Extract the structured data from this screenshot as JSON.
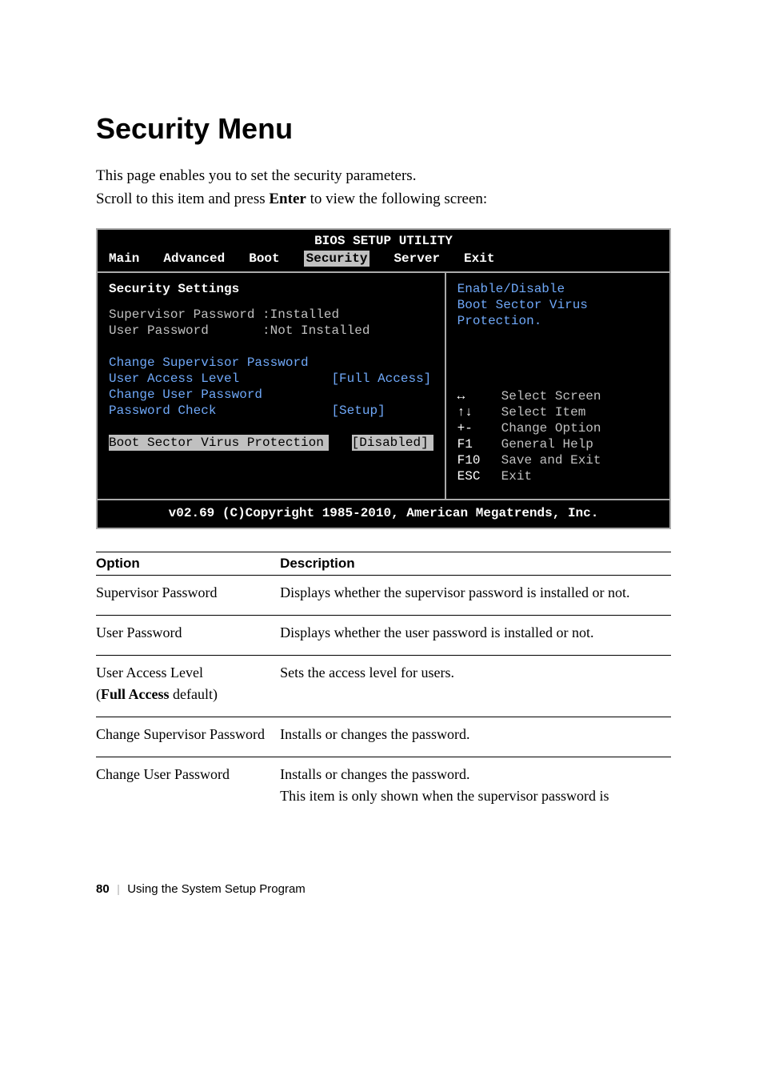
{
  "heading": "Security Menu",
  "intro_line1": "This page enables you to set the security parameters.",
  "intro_line2_a": "Scroll to this item and press ",
  "intro_line2_b": "Enter",
  "intro_line2_c": " to view the following screen:",
  "bios": {
    "title": "BIOS SETUP UTILITY",
    "tabs": {
      "main": "Main",
      "advanced": "Advanced",
      "boot": "Boot",
      "security": "Security",
      "server": "Server",
      "exit": "Exit"
    },
    "left": {
      "section": "Security Settings",
      "sup_label": "Supervisor Password :",
      "sup_val": "Installed",
      "user_label": "User Password       :",
      "user_val": "Not Installed",
      "item_change_sup": "Change Supervisor Password",
      "item_ual": "User Access Level",
      "item_ual_val": "[Full Access]",
      "item_change_user": "Change User Password",
      "item_pwcheck": "Password Check",
      "item_pwcheck_val": "[Setup]",
      "item_bsv": "Boot Sector Virus Protection",
      "item_bsv_val": "[Disabled]"
    },
    "right": {
      "help1": "Enable/Disable",
      "help2": "Boot Sector Virus",
      "help3": "Protection.",
      "keys": [
        {
          "k": "↔",
          "d": "Select Screen"
        },
        {
          "k": "↑↓",
          "d": "Select Item"
        },
        {
          "k": "+-",
          "d": "Change Option"
        },
        {
          "k": "F1",
          "d": "General Help"
        },
        {
          "k": "F10",
          "d": "Save and Exit"
        },
        {
          "k": "ESC",
          "d": "Exit"
        }
      ]
    },
    "footer": "v02.69 (C)Copyright 1985-2010, American Megatrends, Inc."
  },
  "table": {
    "h_option": "Option",
    "h_desc": "Description",
    "rows": [
      {
        "opt": "Supervisor Password",
        "opt2": "",
        "bold2": false,
        "desc": "Displays whether the supervisor password is installed or not."
      },
      {
        "opt": "User Password",
        "opt2": "",
        "bold2": false,
        "desc": "Displays whether the user password is installed or not."
      },
      {
        "opt": "User Access Level",
        "opt2_pre": "(",
        "opt2_bold": "Full Access",
        "opt2_post": " default)",
        "desc": "Sets the access level for users."
      },
      {
        "opt": "Change Supervisor Password",
        "opt2": "",
        "bold2": false,
        "desc": "Installs or changes the password."
      },
      {
        "opt": "Change User Password",
        "opt2": "",
        "bold2": false,
        "desc": "Installs or changes the password.\nThis item is only shown when the supervisor password is"
      }
    ]
  },
  "footer": {
    "page": "80",
    "section": "Using the System Setup Program"
  }
}
